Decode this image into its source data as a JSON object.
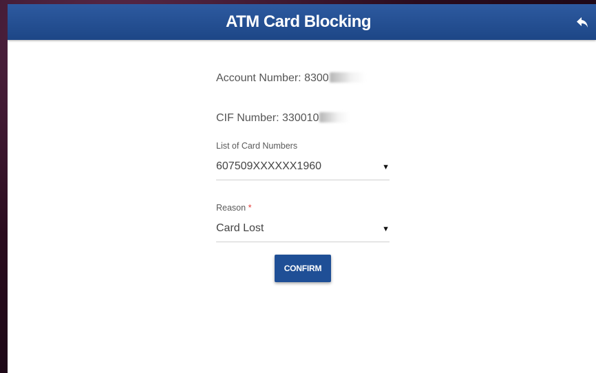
{
  "header": {
    "title": "ATM Card Blocking",
    "back_icon": "reply-back-icon"
  },
  "account": {
    "label": "Account Number: ",
    "value_visible": "8300"
  },
  "cif": {
    "label": "CIF Number: ",
    "value_visible": "330010"
  },
  "card_select": {
    "label": "List of Card Numbers",
    "value": "607509XXXXXX1960"
  },
  "reason_select": {
    "label": "Reason",
    "required_mark": "*",
    "value": "Card Lost"
  },
  "actions": {
    "confirm_label": "CONFIRM"
  },
  "colors": {
    "header": "#1d4686",
    "button": "#1f4f96",
    "required": "#e53935"
  }
}
